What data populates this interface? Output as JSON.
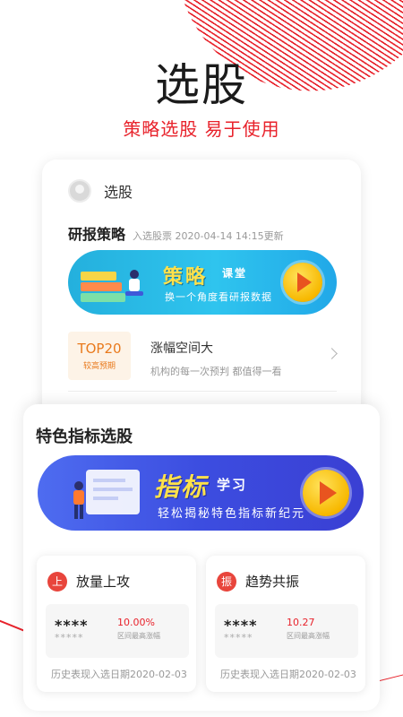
{
  "hero": {
    "title": "选股",
    "subtitle": "策略选股 易于使用"
  },
  "card1": {
    "user_name": "选股",
    "research_title": "研报策略",
    "research_meta": "入选股票  2020-04-14  14:15更新",
    "banner": {
      "title_big": "策略",
      "title_small": "课堂",
      "desc": "换一个角度看研报数据"
    },
    "top_badge": {
      "title": "TOP20",
      "sub": "较高预期"
    },
    "stock_title": "涨幅空间大",
    "stock_desc": "机构的每一次预判  都值得一看"
  },
  "card2": {
    "title": "特色指标选股",
    "banner": {
      "title_big": "指标",
      "title_small": "学习",
      "desc": "轻松揭秘特色指标新纪元"
    },
    "items": [
      {
        "badge": "上",
        "name": "放量上攻",
        "stars_top": "****",
        "stars_bottom": "*****",
        "value": "10.00%",
        "value_label": "区间最高涨幅",
        "history": "历史表现入选日期2020-02-03"
      },
      {
        "badge": "振",
        "name": "趋势共振",
        "stars_top": "****",
        "stars_bottom": "*****",
        "value": "10.27",
        "value_label": "区间最高涨幅",
        "history": "历史表现入选日期2020-02-03"
      }
    ]
  },
  "colors": {
    "accent_red": "#e8222b",
    "orange": "#e97a1d",
    "banner1_blue": "#2fc4ee",
    "banner2_indigo": "#3c4de0",
    "play_yellow": "#f7b800"
  },
  "icons": [
    "avatar-icon",
    "chevron-right-icon",
    "play-icon",
    "books-illustration",
    "person-illustration"
  ]
}
